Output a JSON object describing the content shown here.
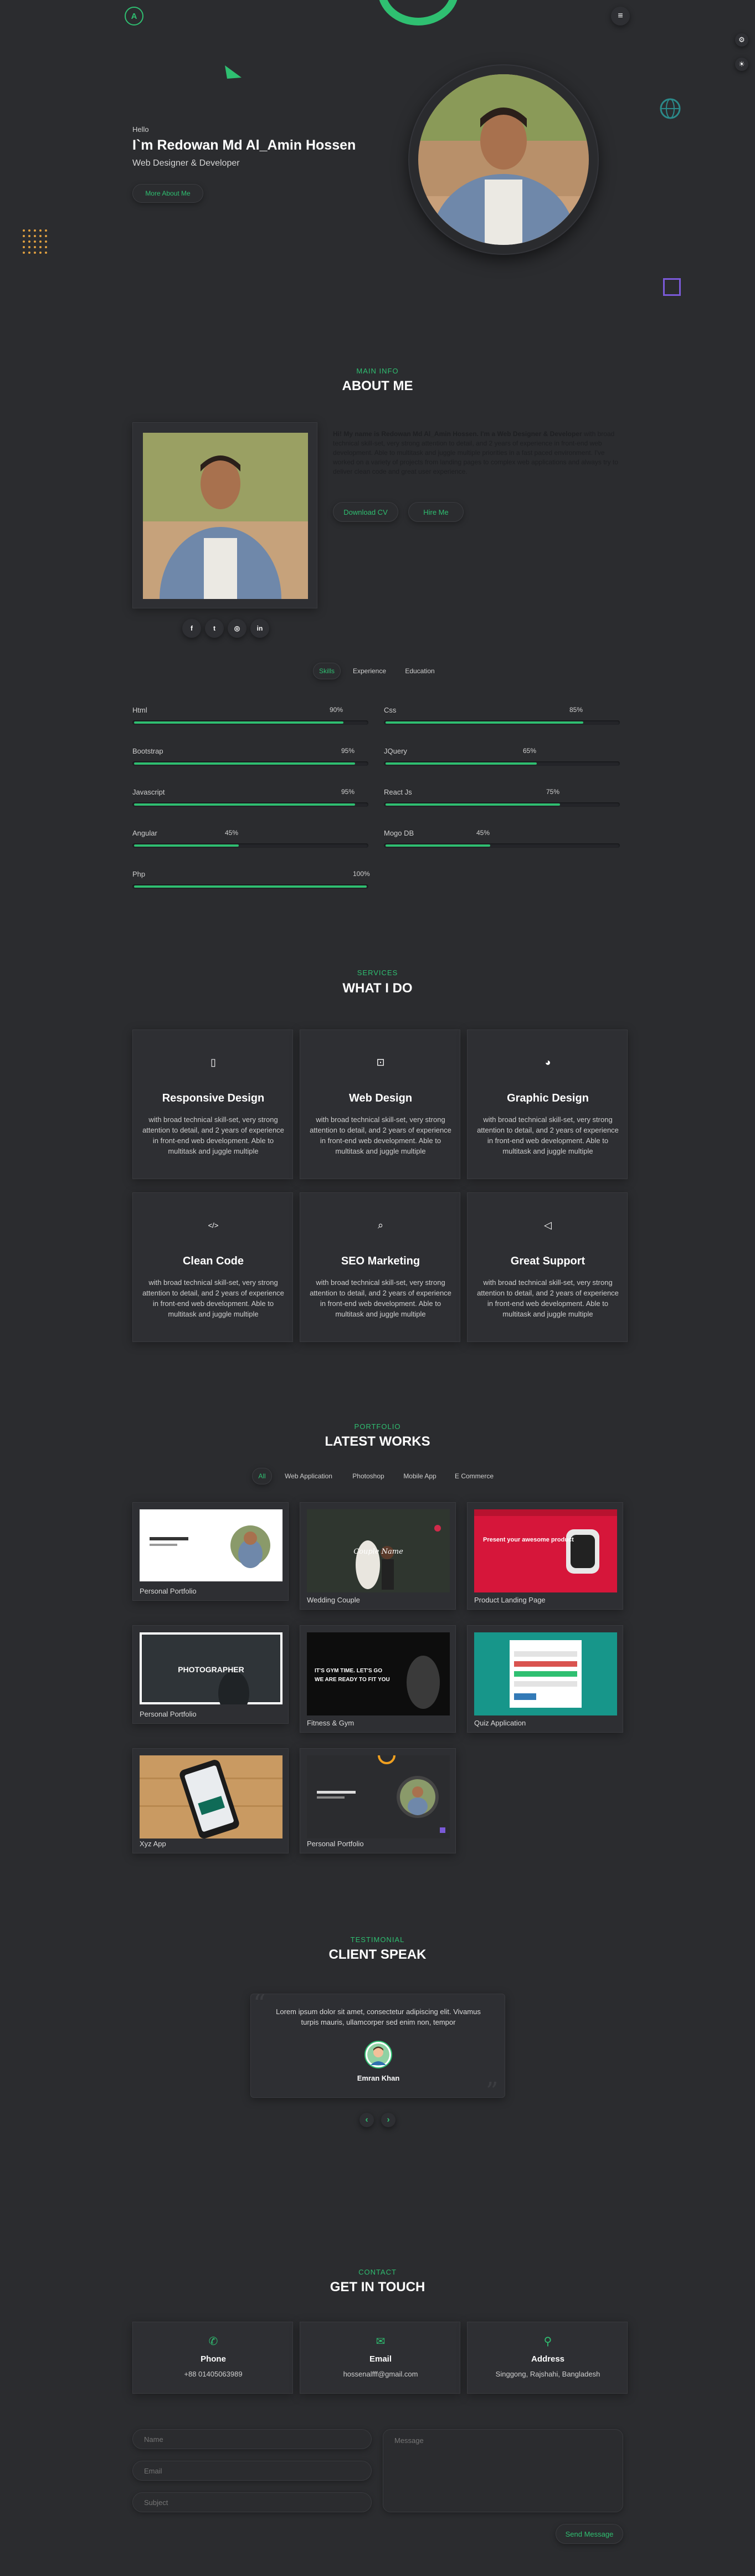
{
  "nav": {
    "logo": "A",
    "menu_icon": "≡"
  },
  "hero": {
    "greeting": "Hello",
    "name": "I`m Redowan Md Al_Amin Hossen",
    "role": "Web Designer & Developer",
    "button": "More About Me"
  },
  "about": {
    "sub": "Main Info",
    "title": "About Me",
    "bio_lead": "Hi! My name is Redowan Md Al_Amin Hossen. I'm a Web Designer & Developer",
    "bio_rest": " with broad technical skill-set, very strong attention to detail, and 2 years of experience in front-end web development. Able to multitask and juggle multiple priorities in a fast paced environment. I've worked on a variety of projects from landing pages to complex web applications and always try to deliver clean code and great user experience.",
    "download_cv": "Download CV",
    "hire_me": "Hire Me",
    "socials": [
      "f",
      "t",
      "in-icon",
      "in"
    ],
    "tabs": [
      "Skills",
      "Experience",
      "Education"
    ]
  },
  "skills": [
    {
      "name": "Html",
      "pct": "90%",
      "value": 90
    },
    {
      "name": "Css",
      "pct": "85%",
      "value": 85
    },
    {
      "name": "Bootstrap",
      "pct": "95%",
      "value": 95
    },
    {
      "name": "JQuery",
      "pct": "65%",
      "value": 65
    },
    {
      "name": "Javascript",
      "pct": "95%",
      "value": 95
    },
    {
      "name": "React Js",
      "pct": "75%",
      "value": 75
    },
    {
      "name": "Angular",
      "pct": "45%",
      "value": 45
    },
    {
      "name": "Mogo DB",
      "pct": "45%",
      "value": 45
    },
    {
      "name": "Php",
      "pct": "100%",
      "value": 100
    }
  ],
  "services": {
    "sub": "Services",
    "title": "What I Do",
    "items": [
      {
        "icon": "mobile-icon",
        "title": "Responsive Design",
        "desc": "with broad technical skill-set, very strong attention to detail, and 2 years of experience in front-end web development. Able to multitask and juggle multiple"
      },
      {
        "icon": "laptop-icon",
        "title": "Web Design",
        "desc": "with broad technical skill-set, very strong attention to detail, and 2 years of experience in front-end web development. Able to multitask and juggle multiple"
      },
      {
        "icon": "palette-icon",
        "title": "Graphic Design",
        "desc": "with broad technical skill-set, very strong attention to detail, and 2 years of experience in front-end web development. Able to multitask and juggle multiple"
      },
      {
        "icon": "code-icon",
        "title": "Clean Code",
        "desc": "with broad technical skill-set, very strong attention to detail, and 2 years of experience in front-end web development. Able to multitask and juggle multiple"
      },
      {
        "icon": "search-icon",
        "title": "SEO Marketing",
        "desc": "with broad technical skill-set, very strong attention to detail, and 2 years of experience in front-end web development. Able to multitask and juggle multiple"
      },
      {
        "icon": "megaphone-icon",
        "title": "Great Support",
        "desc": "with broad technical skill-set, very strong attention to detail, and 2 years of experience in front-end web development. Able to multitask and juggle multiple"
      }
    ]
  },
  "portfolio": {
    "sub": "Portfolio",
    "title": "Latest Works",
    "filters": [
      "All",
      "Web Application",
      "Photoshop",
      "Mobile App",
      "E Commerce"
    ],
    "works": [
      {
        "caption": "Personal Portfolio"
      },
      {
        "caption": "Wedding Couple"
      },
      {
        "caption": "Product Landing Page"
      },
      {
        "caption": "Personal Portfolio"
      },
      {
        "caption": "Fitness & Gym"
      },
      {
        "caption": "Quiz Application"
      },
      {
        "caption": "Xyz App"
      },
      {
        "caption": "Personal Portfolio"
      }
    ],
    "shot_text": {
      "wedding": "Couple Name",
      "product_head": "Present your awesome product",
      "photographer": "PHOTOGRAPHER",
      "fitness_1": "IT'S GYM TIME. LET'S GO",
      "fitness_2": "WE ARE READY TO FIT YOU"
    }
  },
  "testimonial": {
    "sub": "Testimonial",
    "title": "Client Speak",
    "quote": "Lorem ipsum dolor sit amet, consectetur adipiscing elit. Vivamus turpis mauris, ullamcorper sed enim non, tempor",
    "name": "Emran Khan",
    "prev": "‹",
    "next": "›"
  },
  "contact": {
    "sub": "Contact",
    "title": "Get In Touch",
    "cards": [
      {
        "icon": "phone-icon",
        "label": "Phone",
        "value": "+88 01405063989"
      },
      {
        "icon": "email-icon",
        "label": "Email",
        "value": "hossenalfff@gmail.com"
      },
      {
        "icon": "location-icon",
        "label": "Address",
        "value": "Singgong, Rajshahi, Bangladesh"
      }
    ],
    "form": {
      "name_placeholder": "Name",
      "email_placeholder": "Email",
      "subject_placeholder": "Subject",
      "message_placeholder": "Message",
      "send": "Send Message"
    }
  },
  "colors": {
    "accent": "#2fbf71",
    "background": "#2b2c2f"
  }
}
